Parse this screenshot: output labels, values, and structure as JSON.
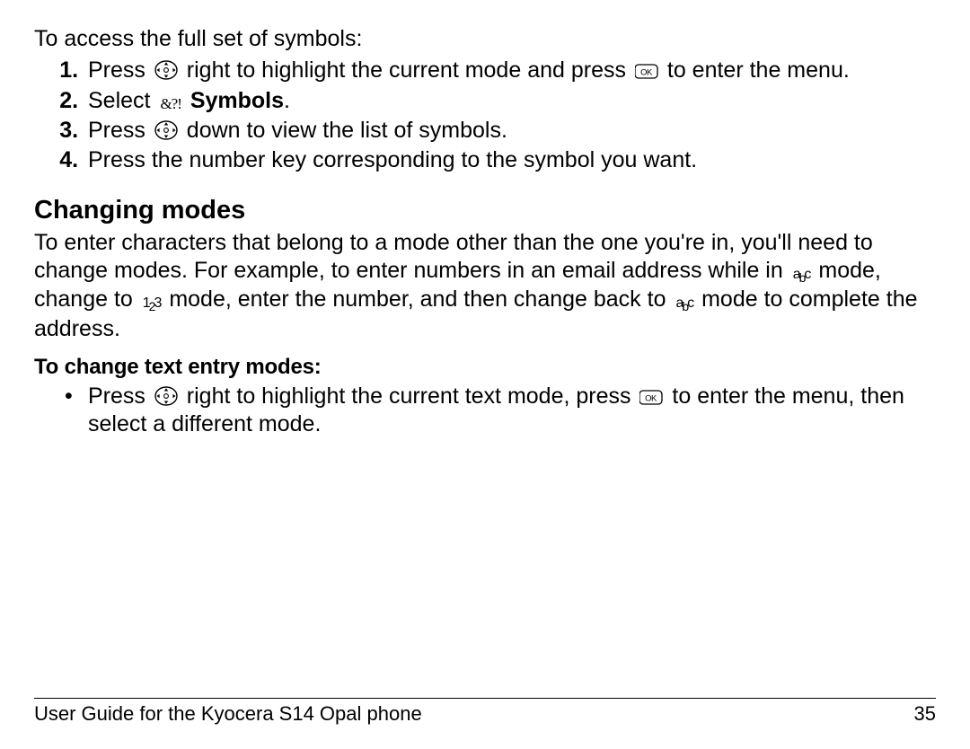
{
  "intro": "To access the full set of symbols:",
  "steps": {
    "s1a": "Press ",
    "s1b": " right to highlight the current mode and press ",
    "s1c": " to enter the menu.",
    "s2a": "Select  ",
    "s2b": " Symbols",
    "s2c": ".",
    "s3a": "Press ",
    "s3b": " down to view the list of symbols.",
    "s4": "Press the number key corresponding to the symbol you want."
  },
  "section_heading": "Changing modes",
  "para_a": "To enter characters that belong to a mode other than the one you're in, you'll need to change modes. For example, to enter numbers in an email address while in ",
  "para_b": " mode, change to ",
  "para_c": " mode, enter the number, and then change back to ",
  "para_d": " mode to complete the address.",
  "subhead": "To change text entry modes:",
  "bullet_a": "Press ",
  "bullet_b": " right to highlight the current text mode, press ",
  "bullet_c": " to enter the menu, then select a different mode.",
  "glyph_abc_a": "a",
  "glyph_abc_b": "b",
  "glyph_abc_c": "c",
  "glyph_123_1": "1",
  "glyph_123_2": "2",
  "glyph_123_3": "3",
  "glyph_sym": "&?!",
  "footer_title": "User Guide for the Kyocera S14 Opal phone",
  "page_number": "35"
}
